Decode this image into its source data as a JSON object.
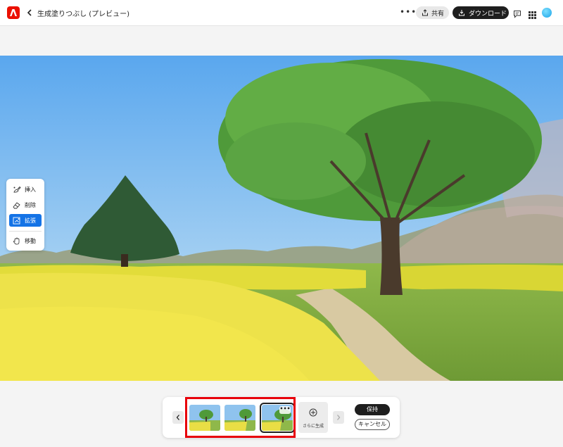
{
  "header": {
    "title": "生成塗りつぶし (プレビュー)",
    "more_label": "•••",
    "share_label": "共有",
    "download_label": "ダウンロード",
    "icons": [
      "adobe-logo-icon",
      "chevron-left-icon",
      "more-icon",
      "share-icon",
      "download-icon",
      "comment-icon",
      "apps-grid-icon",
      "avatar"
    ]
  },
  "tools": {
    "items": [
      {
        "label": "挿入",
        "icon": "insert-brush-icon",
        "active": false
      },
      {
        "label": "削除",
        "icon": "eraser-icon",
        "active": false
      },
      {
        "label": "拡張",
        "icon": "expand-icon",
        "active": true
      },
      {
        "label": "移動",
        "icon": "hand-icon",
        "active": false
      }
    ]
  },
  "variations": {
    "thumb_more_label": "•••",
    "generate_more_label": "さらに生成",
    "keep_label": "保持",
    "cancel_label": "キャンセル",
    "selected_index": 2,
    "count": 3
  },
  "colors": {
    "accent": "#1473e6",
    "brand": "#eb1000",
    "highlight": "#e8000b"
  }
}
